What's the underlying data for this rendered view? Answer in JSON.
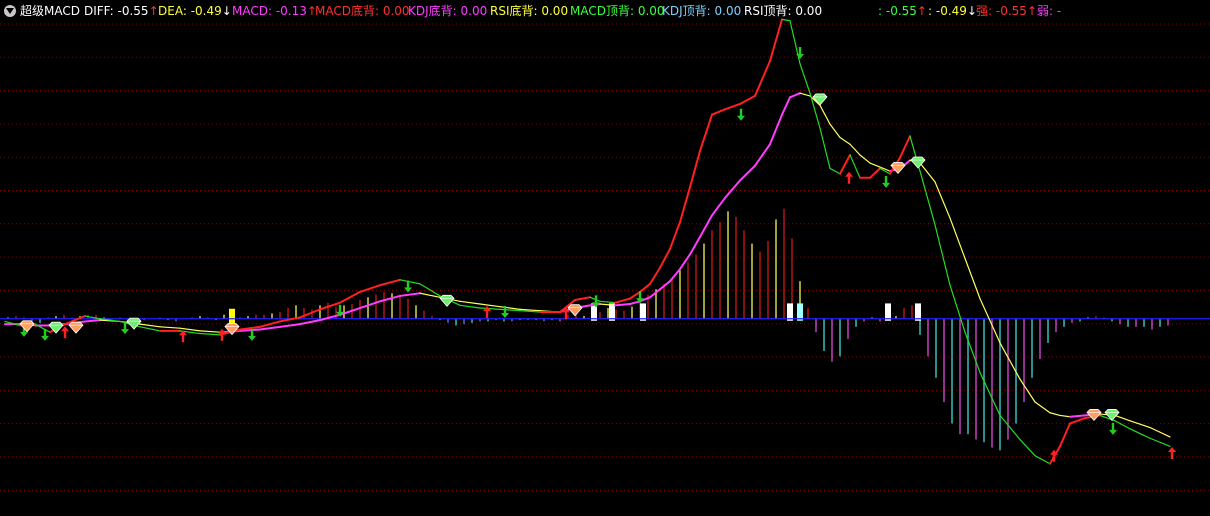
{
  "header": {
    "title": "超级MACD",
    "items": [
      {
        "label": "DIFF",
        "value": "-0.55",
        "arrow": "↑",
        "label_color": "#ffffff",
        "value_color": "#ffffff",
        "arrow_color": "#ff3030"
      },
      {
        "label": "DEA",
        "value": "-0.49",
        "arrow": "↓",
        "label_color": "#ffff3c",
        "value_color": "#ffff3c",
        "arrow_color": "#ffffff"
      },
      {
        "label": "MACD",
        "value": "-0.13",
        "arrow": "↑",
        "label_color": "#ff3cff",
        "value_color": "#ff3cff",
        "arrow_color": "#ff3030"
      },
      {
        "label": "MACD底背",
        "value": "0.00",
        "arrow": "",
        "label_color": "#ff3030",
        "value_color": "#ff3030",
        "arrow_color": ""
      },
      {
        "label": "KDJ底背",
        "value": "0.00",
        "arrow": "",
        "label_color": "#ff3cff",
        "value_color": "#ff3cff",
        "arrow_color": ""
      },
      {
        "label": "RSI底背",
        "value": "0.00",
        "arrow": "",
        "label_color": "#ffff3c",
        "value_color": "#ffff3c",
        "arrow_color": ""
      },
      {
        "label": "MACD顶背",
        "value": "0.00",
        "arrow": "",
        "label_color": "#3cff3c",
        "value_color": "#3cff3c",
        "arrow_color": ""
      },
      {
        "label": "KDJ顶背",
        "value": "0.00",
        "arrow": "",
        "label_color": "#7fd0ff",
        "value_color": "#7fd0ff",
        "arrow_color": ""
      },
      {
        "label": "RSI顶背",
        "value": "0.00",
        "arrow": "",
        "label_color": "#ffffff",
        "value_color": "#ffffff",
        "arrow_color": ""
      },
      {
        "label": "",
        "value": "-0.55",
        "arrow": "↑",
        "label_color": "#3cff3c",
        "value_color": "#3cff3c",
        "arrow_color": "#ff3030"
      },
      {
        "label": "",
        "value": "-0.49",
        "arrow": "↓",
        "label_color": "#ffff3c",
        "value_color": "#ffff3c",
        "arrow_color": "#ffffff"
      },
      {
        "label": "强",
        "value": "-0.55",
        "arrow": "↑",
        "label_color": "#ff3030",
        "value_color": "#ff3030",
        "arrow_color": "#ff3030"
      },
      {
        "label": "弱",
        "value": "-",
        "arrow": "",
        "label_color": "#ff3cff",
        "value_color": "#ff3cff",
        "arrow_color": ""
      }
    ]
  },
  "colors": {
    "background": "#000000",
    "grid": "#8b0000",
    "zero_line": "#2020ff",
    "diff_up": "#ff2020",
    "diff_down": "#22dd22",
    "dea": "#ff3cff",
    "dea_alt": "#ffff60",
    "bar_pos_red": "#c01818",
    "bar_pos_yellow": "#e6e64a",
    "bar_neg_cyan": "#38cccc",
    "bar_neg_magenta": "#cc44cc",
    "highlight_white": "#ffffff",
    "highlight_yellow": "#ffff00",
    "highlight_cyan": "#a0ffff",
    "arrow_up": "#ff2020",
    "arrow_down": "#22cc22",
    "diamond_orange": "#ff9e60",
    "diamond_green": "#70ee70"
  },
  "chart_data": {
    "type": "line",
    "ylim": [
      -1.35,
      2.3
    ],
    "grid": true,
    "series": [
      {
        "name": "DIFF",
        "x": [
          5,
          20,
          35,
          50,
          65,
          85,
          100,
          120,
          140,
          160,
          180,
          200,
          220,
          240,
          260,
          280,
          300,
          320,
          340,
          360,
          380,
          400,
          420,
          440,
          460,
          480,
          500,
          520,
          540,
          560,
          575,
          590,
          600,
          615,
          630,
          640,
          650,
          660,
          670,
          680,
          690,
          700,
          712,
          725,
          740,
          755,
          770,
          782,
          790,
          800,
          810,
          820,
          830,
          840,
          850,
          860,
          870,
          880,
          890,
          900,
          910,
          920,
          935,
          950,
          965,
          980,
          1000,
          1020,
          1035,
          1050,
          1060,
          1070,
          1085,
          1100,
          1115,
          1130,
          1150,
          1170
        ],
        "y": [
          -0.02,
          -0.05,
          -0.04,
          -0.1,
          -0.04,
          0.02,
          0.0,
          -0.02,
          -0.06,
          -0.09,
          -0.09,
          -0.11,
          -0.12,
          -0.08,
          -0.06,
          -0.02,
          0.01,
          0.07,
          0.12,
          0.2,
          0.25,
          0.29,
          0.26,
          0.17,
          0.1,
          0.08,
          0.07,
          0.06,
          0.05,
          0.05,
          0.14,
          0.16,
          0.13,
          0.12,
          0.15,
          0.2,
          0.26,
          0.38,
          0.52,
          0.72,
          0.98,
          1.25,
          1.52,
          1.56,
          1.6,
          1.66,
          1.92,
          2.23,
          2.22,
          1.9,
          1.68,
          1.42,
          1.12,
          1.08,
          1.22,
          1.05,
          1.05,
          1.12,
          1.08,
          1.2,
          1.36,
          1.1,
          0.7,
          0.25,
          -0.1,
          -0.4,
          -0.72,
          -0.9,
          -1.02,
          -1.08,
          -0.95,
          -0.78,
          -0.74,
          -0.72,
          -0.76,
          -0.82,
          -0.89,
          -0.95
        ]
      },
      {
        "name": "DEA",
        "x": [
          5,
          20,
          35,
          50,
          65,
          85,
          100,
          120,
          140,
          160,
          180,
          200,
          220,
          240,
          260,
          280,
          300,
          320,
          340,
          360,
          380,
          400,
          420,
          440,
          460,
          480,
          500,
          520,
          540,
          560,
          575,
          590,
          600,
          615,
          630,
          640,
          650,
          660,
          670,
          680,
          690,
          700,
          712,
          725,
          740,
          755,
          770,
          782,
          790,
          800,
          810,
          820,
          830,
          840,
          850,
          860,
          870,
          880,
          890,
          900,
          910,
          920,
          935,
          950,
          965,
          980,
          1000,
          1020,
          1035,
          1050,
          1060,
          1070,
          1085,
          1100,
          1115,
          1130,
          1150,
          1170
        ],
        "y": [
          -0.04,
          -0.04,
          -0.05,
          -0.05,
          -0.04,
          -0.02,
          -0.01,
          -0.02,
          -0.04,
          -0.06,
          -0.07,
          -0.09,
          -0.1,
          -0.09,
          -0.08,
          -0.06,
          -0.04,
          -0.01,
          0.03,
          0.08,
          0.13,
          0.17,
          0.19,
          0.16,
          0.13,
          0.11,
          0.09,
          0.07,
          0.06,
          0.05,
          0.08,
          0.1,
          0.11,
          0.1,
          0.11,
          0.13,
          0.16,
          0.22,
          0.28,
          0.37,
          0.48,
          0.61,
          0.77,
          0.9,
          1.03,
          1.14,
          1.3,
          1.52,
          1.65,
          1.68,
          1.66,
          1.59,
          1.45,
          1.35,
          1.3,
          1.22,
          1.16,
          1.13,
          1.1,
          1.12,
          1.18,
          1.16,
          1.02,
          0.75,
          0.45,
          0.15,
          -0.18,
          -0.45,
          -0.62,
          -0.7,
          -0.72,
          -0.73,
          -0.72,
          -0.71,
          -0.72,
          -0.76,
          -0.81,
          -0.88
        ]
      },
      {
        "name": "MACD",
        "x": [
          8,
          16,
          24,
          32,
          40,
          48,
          56,
          64,
          72,
          80,
          88,
          96,
          104,
          112,
          120,
          128,
          136,
          144,
          152,
          160,
          168,
          176,
          184,
          192,
          200,
          208,
          216,
          224,
          232,
          240,
          248,
          256,
          264,
          272,
          280,
          288,
          296,
          304,
          312,
          320,
          328,
          336,
          344,
          352,
          360,
          368,
          376,
          384,
          392,
          400,
          408,
          416,
          424,
          432,
          440,
          448,
          456,
          464,
          472,
          480,
          488,
          496,
          504,
          512,
          520,
          528,
          536,
          544,
          552,
          560,
          568,
          576,
          584,
          592,
          600,
          608,
          616,
          624,
          632,
          640,
          648,
          656,
          664,
          672,
          680,
          688,
          696,
          704,
          712,
          720,
          728,
          736,
          744,
          752,
          760,
          768,
          776,
          784,
          792,
          800,
          808,
          816,
          824,
          832,
          840,
          848,
          856,
          864,
          872,
          880,
          888,
          896,
          904,
          912,
          920,
          928,
          936,
          944,
          952,
          960,
          968,
          976,
          984,
          992,
          1000,
          1008,
          1016,
          1024,
          1032,
          1040,
          1048,
          1056,
          1064,
          1072,
          1080,
          1088,
          1096,
          1104,
          1112,
          1120,
          1128,
          1136,
          1144,
          1152,
          1160,
          1168
        ],
        "y": [
          0.01,
          0.02,
          0.01,
          -0.02,
          -0.03,
          0.01,
          0.02,
          0.03,
          0.01,
          0.02,
          0.03,
          0.03,
          0.01,
          0.0,
          0.01,
          -0.01,
          -0.02,
          -0.01,
          0.0,
          0.01,
          -0.01,
          -0.02,
          0.0,
          0.01,
          0.02,
          0.01,
          -0.01,
          0.03,
          0.02,
          0.01,
          0.02,
          0.03,
          0.03,
          0.04,
          0.05,
          0.08,
          0.1,
          0.08,
          0.07,
          0.1,
          0.12,
          0.09,
          0.1,
          0.11,
          0.14,
          0.16,
          0.18,
          0.2,
          0.19,
          0.18,
          0.15,
          0.1,
          0.06,
          0.02,
          -0.01,
          -0.03,
          -0.05,
          -0.04,
          -0.03,
          -0.02,
          -0.02,
          -0.01,
          -0.02,
          -0.02,
          -0.01,
          -0.01,
          -0.01,
          -0.02,
          -0.01,
          -0.02,
          0.03,
          0.04,
          0.02,
          0.06,
          0.05,
          0.08,
          0.07,
          0.06,
          0.09,
          0.12,
          0.18,
          0.22,
          0.26,
          0.3,
          0.36,
          0.42,
          0.48,
          0.56,
          0.66,
          0.72,
          0.8,
          0.76,
          0.66,
          0.56,
          0.5,
          0.58,
          0.74,
          0.82,
          0.6,
          0.28,
          0.08,
          -0.1,
          -0.24,
          -0.32,
          -0.28,
          -0.15,
          -0.06,
          -0.02,
          0.01,
          -0.02,
          -0.01,
          0.02,
          0.08,
          0.1,
          -0.12,
          -0.28,
          -0.44,
          -0.62,
          -0.78,
          -0.86,
          -0.86,
          -0.9,
          -0.92,
          -0.96,
          -0.98,
          -0.9,
          -0.78,
          -0.62,
          -0.44,
          -0.3,
          -0.18,
          -0.1,
          -0.06,
          -0.03,
          -0.02,
          0.01,
          0.02,
          0.01,
          -0.02,
          -0.04,
          -0.06,
          -0.06,
          -0.06,
          -0.08,
          -0.06,
          -0.05
        ]
      }
    ],
    "highlight_bars": [
      {
        "x": 232,
        "value": -0.07,
        "color": "yellow"
      },
      {
        "x": 594,
        "value": 0.04,
        "color": "white"
      },
      {
        "x": 612,
        "value": 0.04,
        "color": "white"
      },
      {
        "x": 643,
        "value": 0.04,
        "color": "white"
      },
      {
        "x": 790,
        "value": 0.04,
        "color": "white"
      },
      {
        "x": 800,
        "value": 0.04,
        "color": "cyan"
      },
      {
        "x": 888,
        "value": 0.04,
        "color": "white"
      },
      {
        "x": 918,
        "value": 0.04,
        "color": "white"
      }
    ],
    "signals": [
      {
        "x": 24,
        "y": -0.09,
        "type": "arrow_down"
      },
      {
        "x": 45,
        "y": -0.12,
        "type": "arrow_down"
      },
      {
        "x": 65,
        "y": -0.1,
        "type": "arrow_up"
      },
      {
        "x": 125,
        "y": -0.07,
        "type": "arrow_down"
      },
      {
        "x": 183,
        "y": -0.13,
        "type": "arrow_up"
      },
      {
        "x": 222,
        "y": -0.12,
        "type": "arrow_up"
      },
      {
        "x": 252,
        "y": -0.12,
        "type": "arrow_down"
      },
      {
        "x": 340,
        "y": 0.06,
        "type": "arrow_down"
      },
      {
        "x": 408,
        "y": 0.24,
        "type": "arrow_down"
      },
      {
        "x": 487,
        "y": 0.05,
        "type": "arrow_up"
      },
      {
        "x": 505,
        "y": 0.05,
        "type": "arrow_down"
      },
      {
        "x": 566,
        "y": 0.04,
        "type": "arrow_up"
      },
      {
        "x": 596,
        "y": 0.13,
        "type": "arrow_down"
      },
      {
        "x": 640,
        "y": 0.16,
        "type": "arrow_down"
      },
      {
        "x": 741,
        "y": 1.52,
        "type": "arrow_down"
      },
      {
        "x": 800,
        "y": 1.98,
        "type": "arrow_down"
      },
      {
        "x": 849,
        "y": 1.05,
        "type": "arrow_up"
      },
      {
        "x": 886,
        "y": 1.02,
        "type": "arrow_down"
      },
      {
        "x": 1054,
        "y": -1.02,
        "type": "arrow_up"
      },
      {
        "x": 1113,
        "y": -0.82,
        "type": "arrow_down"
      },
      {
        "x": 1172,
        "y": -1.0,
        "type": "arrow_up"
      },
      {
        "x": 27,
        "y": -0.06,
        "type": "diamond_orange"
      },
      {
        "x": 56,
        "y": -0.07,
        "type": "diamond_green"
      },
      {
        "x": 76,
        "y": -0.07,
        "type": "diamond_orange"
      },
      {
        "x": 134,
        "y": -0.04,
        "type": "diamond_green"
      },
      {
        "x": 232,
        "y": -0.08,
        "type": "diamond_orange"
      },
      {
        "x": 447,
        "y": 0.13,
        "type": "diamond_green"
      },
      {
        "x": 575,
        "y": 0.06,
        "type": "diamond_orange"
      },
      {
        "x": 820,
        "y": 1.63,
        "type": "diamond_green"
      },
      {
        "x": 898,
        "y": 1.12,
        "type": "diamond_orange"
      },
      {
        "x": 918,
        "y": 1.16,
        "type": "diamond_green"
      },
      {
        "x": 1094,
        "y": -0.72,
        "type": "diamond_orange"
      },
      {
        "x": 1112,
        "y": -0.72,
        "type": "diamond_green"
      }
    ]
  }
}
